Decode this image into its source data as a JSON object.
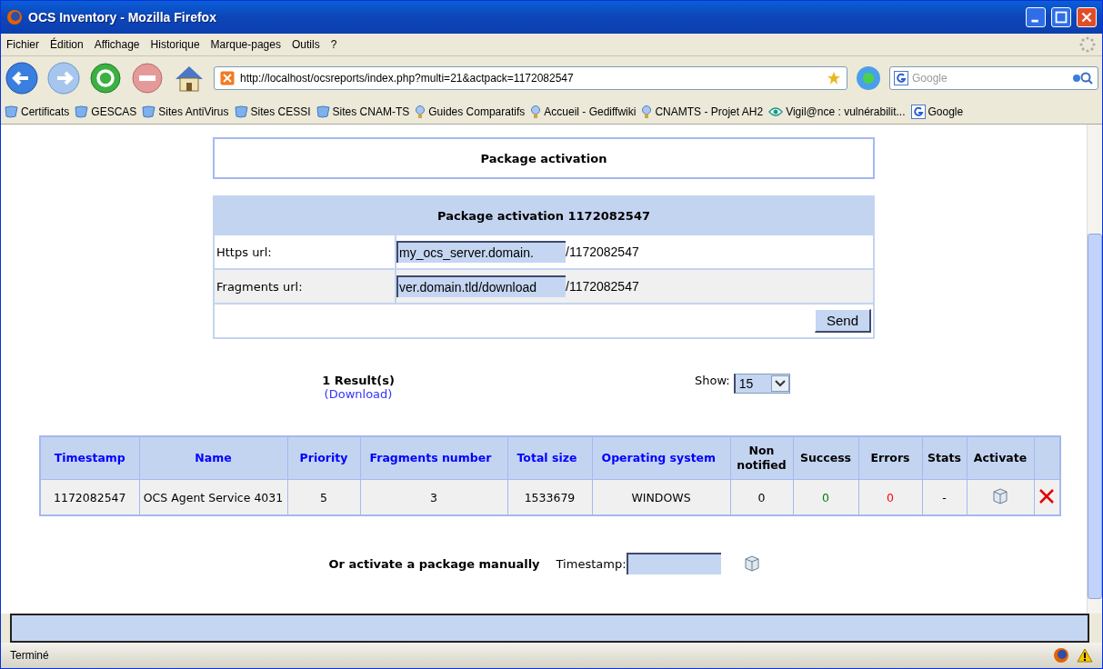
{
  "window": {
    "title": "OCS Inventory - Mozilla Firefox"
  },
  "menu": [
    "Fichier",
    "Édition",
    "Affichage",
    "Historique",
    "Marque-pages",
    "Outils",
    "?"
  ],
  "navigation": {
    "address": "http://localhost/ocsreports/index.php?multi=21&actpack=1172082547",
    "search_placeholder": "Google"
  },
  "bookmarks": [
    {
      "label": "Certificats",
      "kind": "folder"
    },
    {
      "label": "GESCAS",
      "kind": "folder"
    },
    {
      "label": "Sites AntiVirus",
      "kind": "folder"
    },
    {
      "label": "Sites CESSI",
      "kind": "folder"
    },
    {
      "label": "Sites CNAM-TS",
      "kind": "folder"
    },
    {
      "label": "Guides Comparatifs",
      "kind": "bulb"
    },
    {
      "label": "Accueil - Gediffwiki",
      "kind": "bulb"
    },
    {
      "label": "CNAMTS - Projet AH2",
      "kind": "bulb"
    },
    {
      "label": "Vigil@nce : vulnérabilit...",
      "kind": "eye"
    },
    {
      "label": "Google",
      "kind": "google"
    }
  ],
  "page": {
    "header": "Package activation",
    "form": {
      "title": "Package activation 1172082547",
      "fields": [
        {
          "label": "Https url:",
          "value": "my_ocs_server.domain.",
          "suffix": "/1172082547"
        },
        {
          "label": "Fragments url:",
          "value": "ver.domain.tld/download",
          "suffix": "/1172082547"
        }
      ],
      "button": "Send"
    },
    "results": {
      "count": "1 Result(s)",
      "download": "(Download)",
      "show_label": "Show:",
      "show_value": "15"
    },
    "table": {
      "columns": [
        {
          "label": "Timestamp",
          "link": true
        },
        {
          "label": "Name",
          "link": true
        },
        {
          "label": "Priority",
          "link": true
        },
        {
          "label": "Fragments number",
          "link": true
        },
        {
          "label": "Total size",
          "link": true
        },
        {
          "label": "Operating system",
          "link": true
        },
        {
          "label": "Non notified",
          "link": false
        },
        {
          "label": "Success",
          "link": false
        },
        {
          "label": "Errors",
          "link": false
        },
        {
          "label": "Stats",
          "link": false
        },
        {
          "label": "Activate",
          "link": false
        }
      ],
      "rows": [
        {
          "cells": [
            {
              "text": "1172082547"
            },
            {
              "text": "OCS Agent Service 4031"
            },
            {
              "text": "5"
            },
            {
              "text": "3"
            },
            {
              "text": "1533679"
            },
            {
              "text": "WINDOWS"
            },
            {
              "text": "0"
            },
            {
              "text": "0",
              "color": "#008000"
            },
            {
              "text": "0",
              "color": "#ff0000"
            },
            {
              "text": "-"
            }
          ]
        }
      ]
    },
    "manual": {
      "label": "Or activate a package manually",
      "timestamp_label": "Timestamp:"
    }
  },
  "status_bar": {
    "text": "Terminé"
  }
}
